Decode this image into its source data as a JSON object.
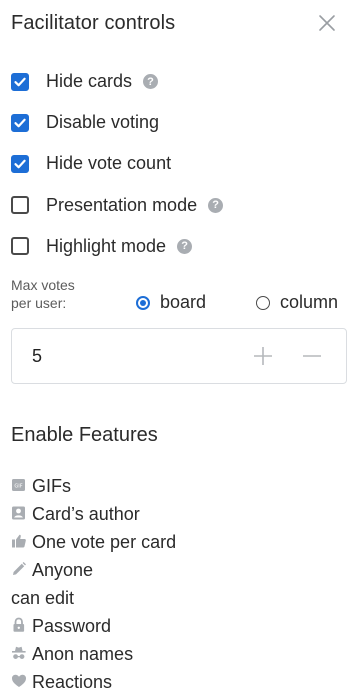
{
  "panel": {
    "title": "Facilitator controls",
    "close_icon": "close-icon"
  },
  "controls": [
    {
      "label": "Hide cards",
      "checked": true,
      "help": true
    },
    {
      "label": "Disable voting",
      "checked": true,
      "help": false
    },
    {
      "label": "Hide vote count",
      "checked": true,
      "help": false
    },
    {
      "label": "Presentation mode",
      "checked": false,
      "help": true
    },
    {
      "label": "Highlight mode",
      "checked": false,
      "help": true
    }
  ],
  "help_glyph": "?",
  "max_votes": {
    "label_line1": "Max votes",
    "label_line2": "per user:",
    "options": [
      {
        "label": "board",
        "selected": true
      },
      {
        "label": "column",
        "selected": false
      }
    ],
    "value": "5"
  },
  "features": {
    "title": "Enable Features",
    "items": [
      {
        "icon": "gif-icon",
        "label": "GIFs"
      },
      {
        "icon": "person-icon",
        "label": "Card’s author"
      },
      {
        "icon": "thumbs-up-icon",
        "label": "One vote per card"
      },
      {
        "icon": "pencil-icon",
        "label_line1": "Anyone",
        "label_line2": "can edit"
      },
      {
        "icon": "lock-icon",
        "label": "Password"
      },
      {
        "icon": "incognito-icon",
        "label": "Anon names"
      },
      {
        "icon": "heart-icon",
        "label": "Reactions"
      }
    ]
  },
  "colors": {
    "accent": "#1d6ed6",
    "icon_gray": "#a9adb2",
    "text": "#2b2b2b"
  }
}
